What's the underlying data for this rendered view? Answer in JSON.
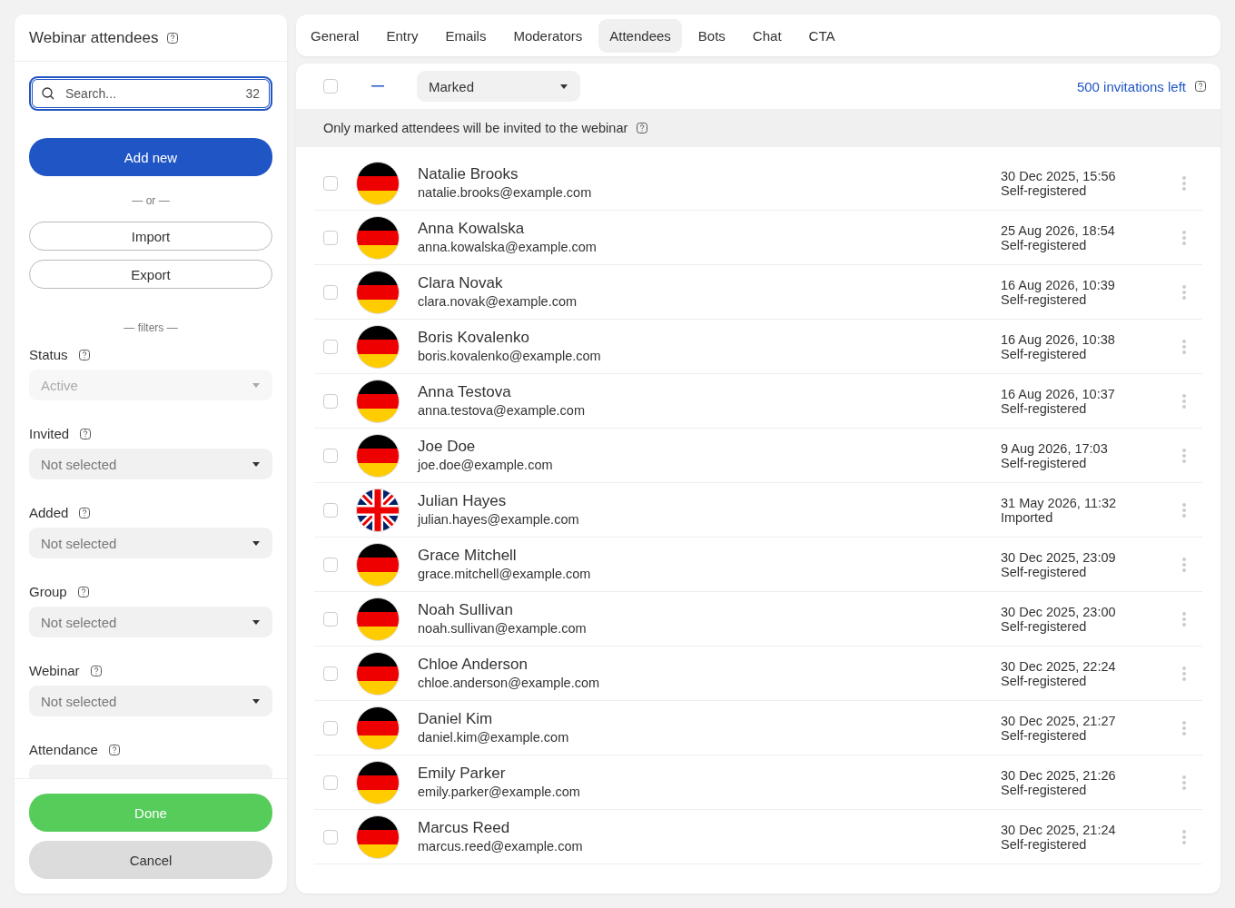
{
  "sidebar": {
    "title": "Webinar attendees",
    "search": {
      "placeholder": "Search...",
      "count": "32"
    },
    "add_button": "Add new",
    "or_label": "— or —",
    "import_button": "Import",
    "export_button": "Export",
    "filters_label": "— filters —",
    "filters": [
      {
        "label": "Status",
        "value": "Active",
        "disabled": true
      },
      {
        "label": "Invited",
        "value": "Not selected",
        "disabled": false
      },
      {
        "label": "Added",
        "value": "Not selected",
        "disabled": false
      },
      {
        "label": "Group",
        "value": "Not selected",
        "disabled": false
      },
      {
        "label": "Webinar",
        "value": "Not selected",
        "disabled": false
      },
      {
        "label": "Attendance"
      }
    ],
    "done_button": "Done",
    "cancel_button": "Cancel"
  },
  "tabs": [
    {
      "label": "General",
      "selected": false
    },
    {
      "label": "Entry",
      "selected": false
    },
    {
      "label": "Emails",
      "selected": false
    },
    {
      "label": "Moderators",
      "selected": false
    },
    {
      "label": "Attendees",
      "selected": true
    },
    {
      "label": "Bots",
      "selected": false
    },
    {
      "label": "Chat",
      "selected": false
    },
    {
      "label": "CTA",
      "selected": false
    }
  ],
  "toolbar": {
    "select_all_checked": false,
    "filter_value": "Marked",
    "invitations_left": "500 invitations left"
  },
  "notice": "Only marked attendees will be invited to the webinar",
  "attendees": [
    {
      "name": "Natalie Brooks",
      "email": "natalie.brooks@example.com",
      "date": "30 Dec 2025, 15:56",
      "source": "Self-registered",
      "kind": "de",
      "checked": false
    },
    {
      "name": "Anna Kowalska",
      "email": "anna.kowalska@example.com",
      "date": "25 Aug 2026, 18:54",
      "source": "Self-registered",
      "kind": "de",
      "checked": false
    },
    {
      "name": "Clara Novak",
      "email": "clara.novak@example.com",
      "date": "16 Aug 2026, 10:39",
      "source": "Self-registered",
      "kind": "de",
      "checked": false
    },
    {
      "name": "Boris Kovalenko",
      "email": "boris.kovalenko@example.com",
      "date": "16 Aug 2026, 10:38",
      "source": "Self-registered",
      "kind": "de",
      "checked": false
    },
    {
      "name": "Anna Testova",
      "email": "anna.testova@example.com",
      "date": "16 Aug 2026, 10:37",
      "source": "Self-registered",
      "kind": "de",
      "checked": false
    },
    {
      "name": "Joe Doe",
      "email": "joe.doe@example.com",
      "date": "9 Aug 2026, 17:03",
      "source": "Self-registered",
      "kind": "de",
      "checked": false
    },
    {
      "name": "Julian Hayes",
      "email": "julian.hayes@example.com",
      "date": "31 May 2026, 11:32",
      "source": "Imported",
      "kind": "gb",
      "checked": false
    },
    {
      "name": "Grace Mitchell",
      "email": "grace.mitchell@example.com",
      "date": "30 Dec 2025, 23:09",
      "source": "Self-registered",
      "kind": "de",
      "checked": false
    },
    {
      "name": "Noah Sullivan",
      "email": "noah.sullivan@example.com",
      "date": "30 Dec 2025, 23:00",
      "source": "Self-registered",
      "kind": "de",
      "checked": false
    },
    {
      "name": "Chloe Anderson",
      "email": "chloe.anderson@example.com",
      "date": "30 Dec 2025, 22:24",
      "source": "Self-registered",
      "kind": "de",
      "checked": false
    },
    {
      "name": "Daniel Kim",
      "email": "daniel.kim@example.com",
      "date": "30 Dec 2025, 21:27",
      "source": "Self-registered",
      "kind": "de",
      "checked": false
    },
    {
      "name": "Emily Parker",
      "email": "emily.parker@example.com",
      "date": "30 Dec 2025, 21:26",
      "source": "Self-registered",
      "kind": "de",
      "checked": false
    },
    {
      "name": "Marcus Reed",
      "email": "marcus.reed@example.com",
      "date": "30 Dec 2025, 21:24",
      "source": "Self-registered",
      "kind": "de",
      "checked": false
    }
  ]
}
